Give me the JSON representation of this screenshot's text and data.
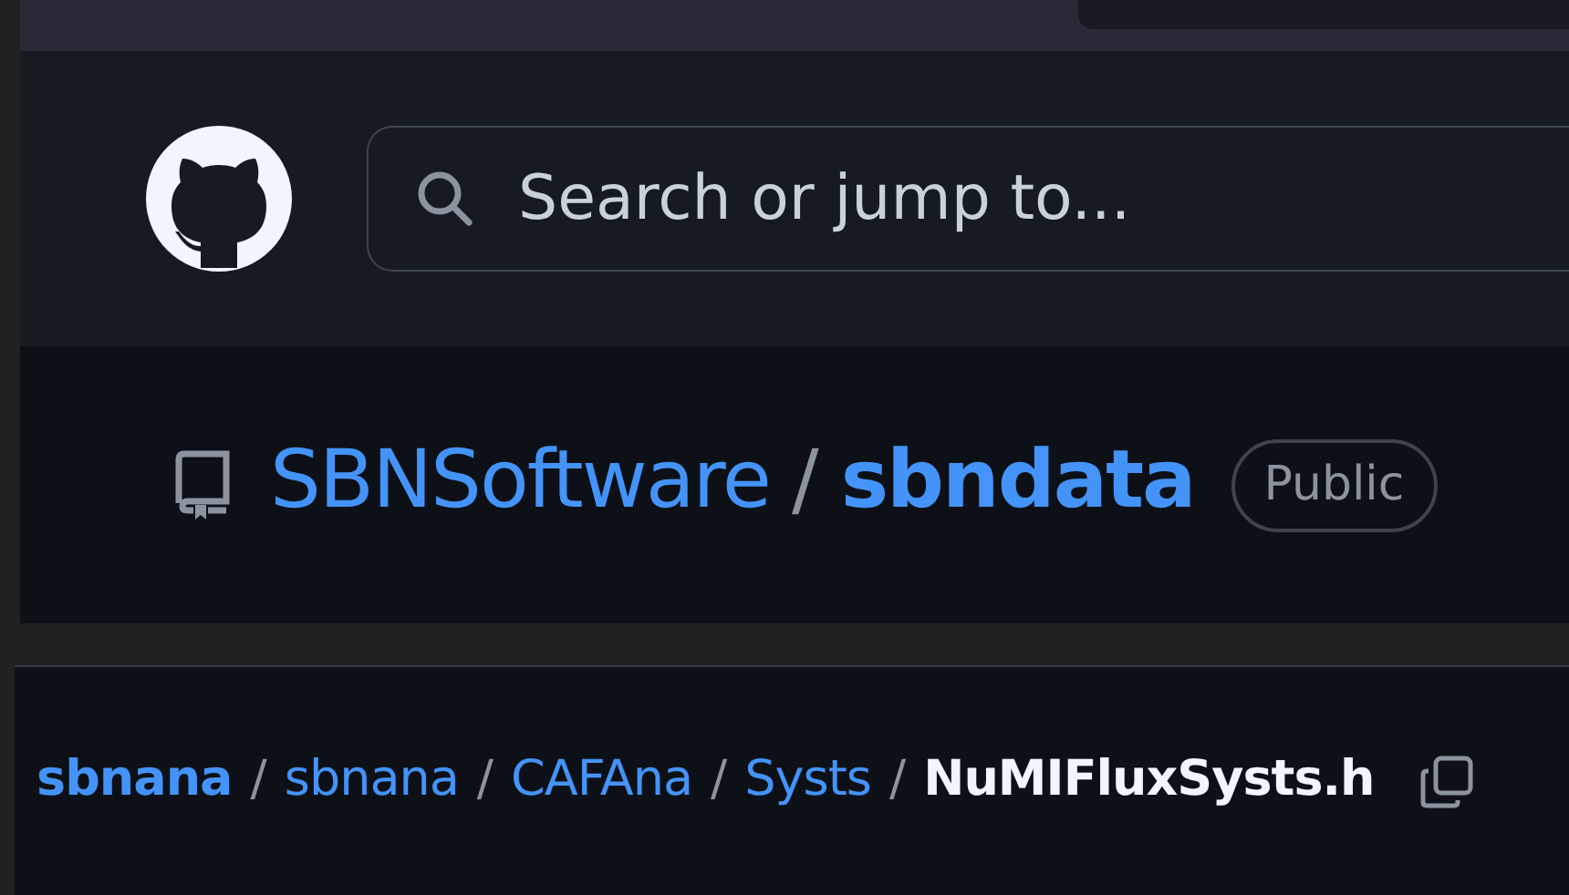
{
  "header": {
    "search": {
      "placeholder": "Search or jump to..."
    }
  },
  "repo": {
    "owner": "SBNSoftware",
    "separator": "/",
    "name": "sbndata",
    "visibility": "Public"
  },
  "breadcrumb": [
    {
      "kind": "root",
      "label": "sbnana"
    },
    {
      "kind": "separator",
      "label": "/"
    },
    {
      "kind": "dir",
      "label": "sbnana"
    },
    {
      "kind": "separator",
      "label": "/"
    },
    {
      "kind": "dir",
      "label": "CAFAna"
    },
    {
      "kind": "separator",
      "label": "/"
    },
    {
      "kind": "dir",
      "label": "Systs"
    },
    {
      "kind": "separator",
      "label": "/"
    },
    {
      "kind": "file",
      "label": "NuMIFluxSysts.h"
    }
  ]
}
